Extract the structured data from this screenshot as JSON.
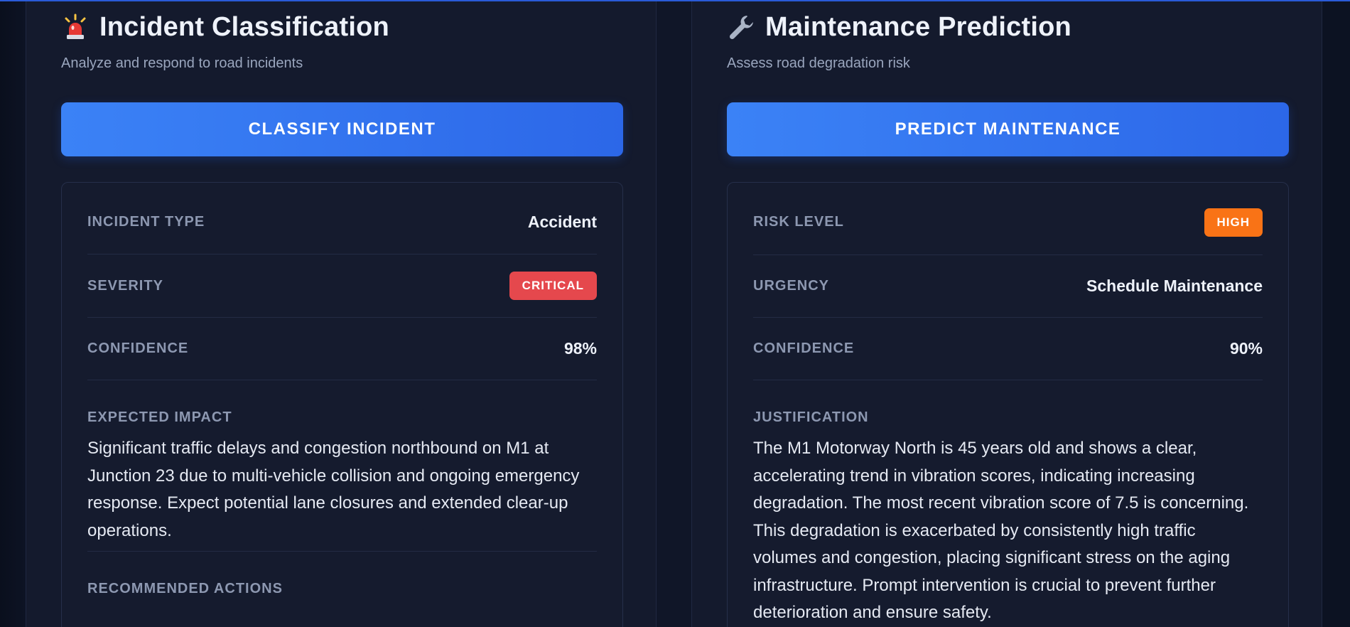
{
  "incident": {
    "icon": "siren-icon",
    "title": "Incident Classification",
    "subtitle": "Analyze and respond to road incidents",
    "button_label": "CLASSIFY INCIDENT",
    "rows": {
      "type_label": "INCIDENT TYPE",
      "type_value": "Accident",
      "severity_label": "SEVERITY",
      "severity_value": "CRITICAL",
      "confidence_label": "CONFIDENCE",
      "confidence_value": "98%"
    },
    "impact_label": "EXPECTED IMPACT",
    "impact_text": "Significant traffic delays and congestion northbound on M1 at Junction 23 due to multi-vehicle collision and ongoing emergency response. Expect potential lane closures and extended clear-up operations.",
    "actions_label": "RECOMMENDED ACTIONS"
  },
  "maintenance": {
    "icon": "wrench-icon",
    "title": "Maintenance Prediction",
    "subtitle": "Assess road degradation risk",
    "button_label": "PREDICT MAINTENANCE",
    "rows": {
      "risk_label": "RISK LEVEL",
      "risk_value": "HIGH",
      "urgency_label": "URGENCY",
      "urgency_value": "Schedule Maintenance",
      "confidence_label": "CONFIDENCE",
      "confidence_value": "90%"
    },
    "justification_label": "JUSTIFICATION",
    "justification_text": "The M1 Motorway North is 45 years old and shows a clear, accelerating trend in vibration scores, indicating increasing degradation. The most recent vibration score of 7.5 is concerning. This degradation is exacerbated by consistently high traffic volumes and congestion, placing significant stress on the aging infrastructure. Prompt intervention is crucial to prevent further deterioration and ensure safety."
  },
  "colors": {
    "accent": "#3b82f6",
    "critical": "#e5484d",
    "high": "#f97316",
    "panel": "#141a2d"
  }
}
